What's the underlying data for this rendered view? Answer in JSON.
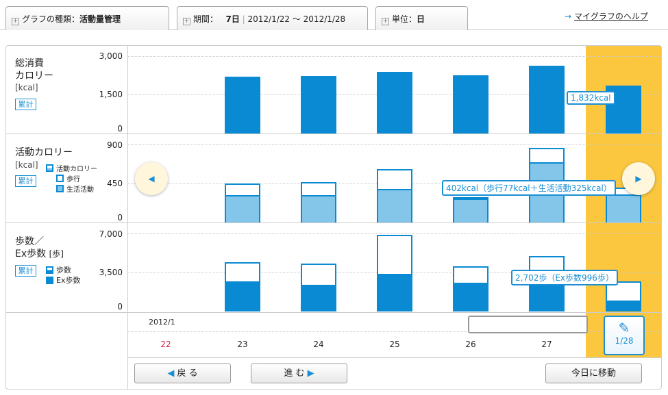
{
  "header": {
    "tabs": [
      {
        "label": "グラフの種類：",
        "value": "活動量管理"
      },
      {
        "label": "期間：",
        "value": "7日",
        "range": "2012/1/22 ～ 2012/1/28"
      },
      {
        "label": "単位：",
        "value": "日"
      }
    ],
    "help_link": "マイグラフのヘルプ"
  },
  "colors": {
    "accent": "#0a8ad2",
    "light_bar": "#84c5ea",
    "highlight": "#fbc73e",
    "sunday": "#d6224a"
  },
  "chart_data": [
    {
      "type": "bar",
      "title": "総消費\nカロリー",
      "title_lines": [
        "総消費",
        "カロリー"
      ],
      "unit": "[kcal]",
      "mode_label": "累計",
      "ylim": [
        0,
        3000
      ],
      "yticks": [
        "3,000",
        "1,500",
        "0"
      ],
      "categories": [
        "22",
        "23",
        "24",
        "25",
        "26",
        "27",
        "28"
      ],
      "values": [
        null,
        2190,
        2210,
        2370,
        2240,
        2600,
        1832
      ],
      "tooltip": "1,832kcal"
    },
    {
      "type": "stacked-bar",
      "title": "活動カロリー",
      "unit": "[kcal]",
      "mode_label": "累計",
      "ylim": [
        0,
        900
      ],
      "yticks": [
        "900",
        "450",
        "0"
      ],
      "legend": [
        "活動カロリー",
        "歩行",
        "生活活動"
      ],
      "categories": [
        "22",
        "23",
        "24",
        "25",
        "26",
        "27",
        "28"
      ],
      "series": [
        {
          "name": "生活活動",
          "values": [
            null,
            316,
            316,
            387,
            276,
            695,
            325
          ]
        },
        {
          "name": "歩行",
          "values": [
            null,
            134,
            150,
            229,
            20,
            165,
            77
          ]
        }
      ],
      "tooltip": "402kcal（歩行77kcal＋生活活動325kcal）"
    },
    {
      "type": "stacked-bar",
      "title_lines": [
        "歩数／",
        "Ex歩数"
      ],
      "unit": "[歩]",
      "mode_label": "累計",
      "ylim": [
        0,
        7000
      ],
      "yticks": [
        "7,000",
        "3,500",
        "0"
      ],
      "legend": [
        "歩数",
        "Ex歩数"
      ],
      "categories": [
        "22",
        "23",
        "24",
        "25",
        "26",
        "27",
        "28"
      ],
      "series": [
        {
          "name": "Ex歩数",
          "values": [
            null,
            2700,
            2400,
            3380,
            2580,
            2500,
            996
          ]
        },
        {
          "name": "歩数",
          "values": [
            null,
            4420,
            4300,
            6880,
            4050,
            4970,
            2702
          ]
        }
      ],
      "tooltip": "2,702歩（Ex歩数996歩）"
    }
  ],
  "timeline": {
    "month": "2012/1",
    "days": [
      "22",
      "23",
      "24",
      "25",
      "26",
      "27"
    ],
    "selected": "1/28"
  },
  "buttons": {
    "back": "戻 る",
    "forward": "進 む",
    "today": "今日に移動"
  }
}
